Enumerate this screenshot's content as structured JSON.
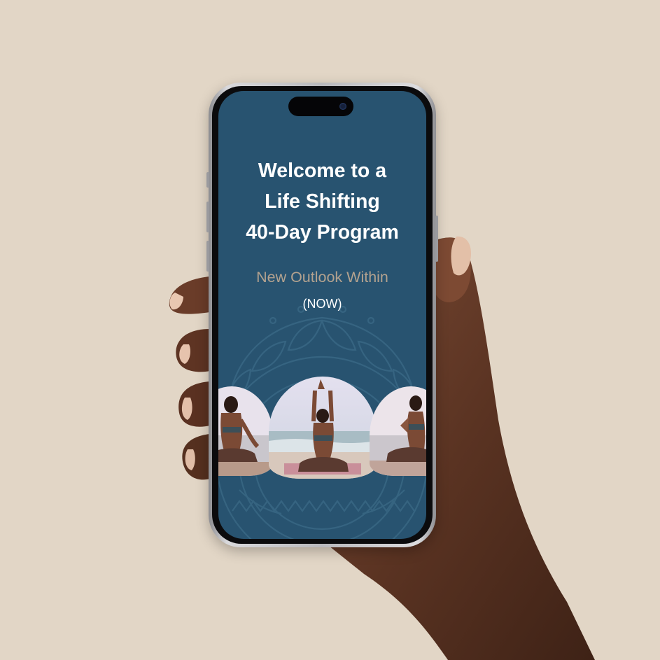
{
  "colors": {
    "background": "#e2d6c6",
    "screen": "#285370",
    "title": "#ffffff",
    "subtitle": "#b3a28f"
  },
  "screen": {
    "title_lines": [
      "Welcome to a",
      "Life Shifting",
      "40-Day Program"
    ],
    "subtitle": "New Outlook Within",
    "tagline": "(NOW)"
  },
  "images": [
    {
      "name": "meditation-photo-left",
      "description": "woman seated cross-legged, back view, hands on knees"
    },
    {
      "name": "meditation-photo-center",
      "description": "woman seated cross-legged on beach, arms raised overhead"
    },
    {
      "name": "meditation-photo-right",
      "description": "woman seated cross-legged, side view, hands in prayer"
    }
  ]
}
